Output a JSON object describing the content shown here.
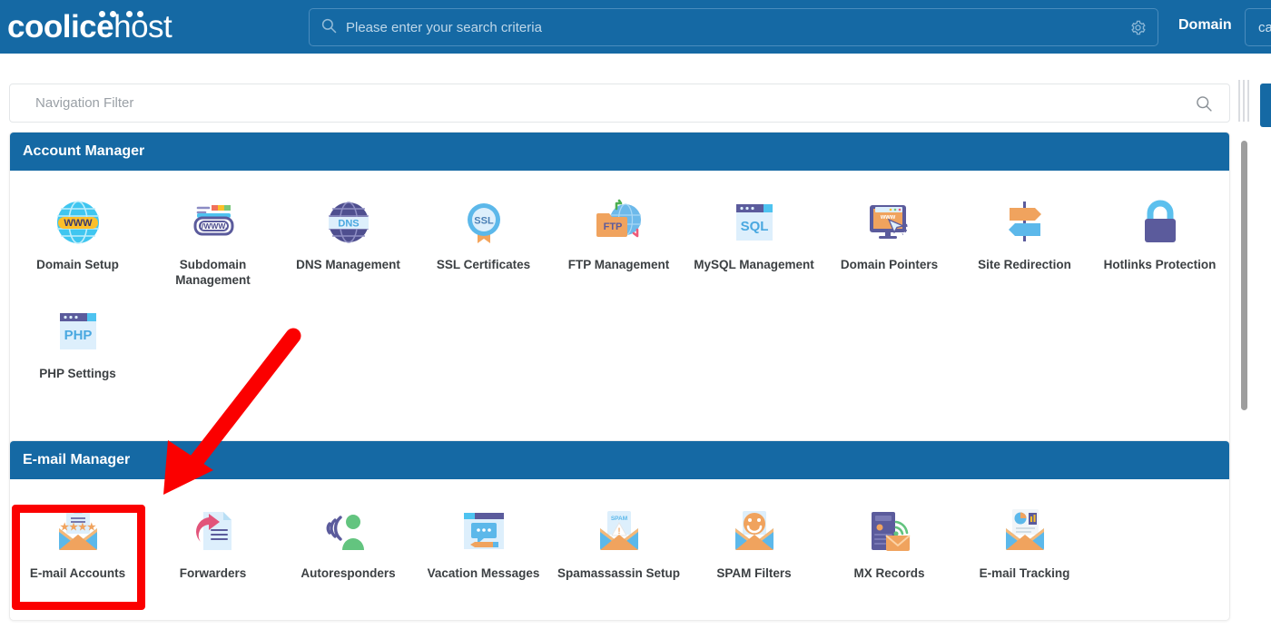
{
  "header": {
    "logo_bold": "coolice",
    "logo_light": "host",
    "search_placeholder": "Please enter your search criteria",
    "search_value": "",
    "gear_icon": "gear-icon",
    "search_icon": "search-icon",
    "domain_label": "Domain",
    "domain_selected": "ca"
  },
  "nav_filter": {
    "placeholder": "Navigation Filter",
    "value": "",
    "icon": "search-icon"
  },
  "sections": [
    {
      "title": "Account Manager",
      "items": [
        {
          "label": "Domain Setup",
          "icon": "globe-www-icon"
        },
        {
          "label": "Subdomain Management",
          "icon": "browser-url-icon"
        },
        {
          "label": "DNS Management",
          "icon": "globe-dns-icon"
        },
        {
          "label": "SSL Certificates",
          "icon": "ssl-badge-icon"
        },
        {
          "label": "FTP Management",
          "icon": "ftp-folder-icon"
        },
        {
          "label": "MySQL Management",
          "icon": "sql-window-icon"
        },
        {
          "label": "Domain Pointers",
          "icon": "monitor-www-cursor-icon"
        },
        {
          "label": "Site Redirection",
          "icon": "signpost-arrows-icon"
        },
        {
          "label": "Hotlinks Protection",
          "icon": "padlock-icon"
        },
        {
          "label": "PHP Settings",
          "icon": "php-window-icon"
        }
      ]
    },
    {
      "title": "E-mail Manager",
      "items": [
        {
          "label": "E-mail Accounts",
          "icon": "envelope-password-icon"
        },
        {
          "label": "Forwarders",
          "icon": "document-forward-arrow-icon"
        },
        {
          "label": "Autoresponders",
          "icon": "person-broadcast-icon"
        },
        {
          "label": "Vacation Messages",
          "icon": "window-chat-pencil-icon"
        },
        {
          "label": "Spamassassin Setup",
          "icon": "envelope-spam-warning-icon"
        },
        {
          "label": "SPAM Filters",
          "icon": "envelope-smiley-icon"
        },
        {
          "label": "MX Records",
          "icon": "server-wifi-envelope-icon"
        },
        {
          "label": "E-mail Tracking",
          "icon": "envelope-chart-icon"
        }
      ]
    }
  ],
  "annotations": {
    "arrow": "red-arrow-annotation",
    "highlight": "red-highlight-box",
    "highlight_target": "E-mail Accounts",
    "color": "#fb0000"
  },
  "colors": {
    "brand_blue": "#1569a4",
    "annotation_red": "#fb0000",
    "text_dark": "#3c4043"
  }
}
